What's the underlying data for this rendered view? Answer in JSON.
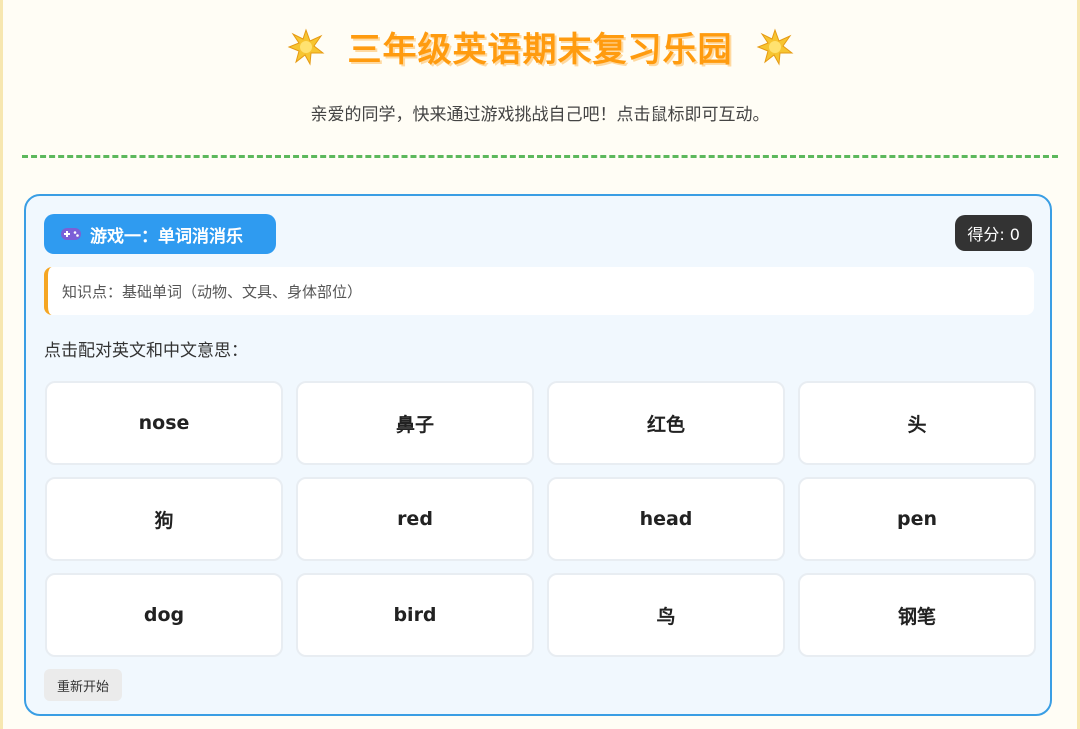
{
  "header": {
    "title": "三年级英语期末复习乐园",
    "subtitle": "亲爱的同学，快来通过游戏挑战自己吧！点击鼠标即可互动。",
    "decoration_icon": "star-icon",
    "title_color": "#ff9b0f"
  },
  "game1": {
    "icon": "gamepad-icon",
    "title": "游戏一：单词消消乐",
    "score_label": "得分: 0",
    "knowledge": "知识点：基础单词（动物、文具、身体部位）",
    "instruction": "点击配对英文和中文意思：",
    "cards": [
      "nose",
      "鼻子",
      "红色",
      "头",
      "狗",
      "red",
      "head",
      "pen",
      "dog",
      "bird",
      "鸟",
      "钢笔"
    ],
    "restart_label": "重新开始",
    "accent_color": "#2f9bf0"
  }
}
